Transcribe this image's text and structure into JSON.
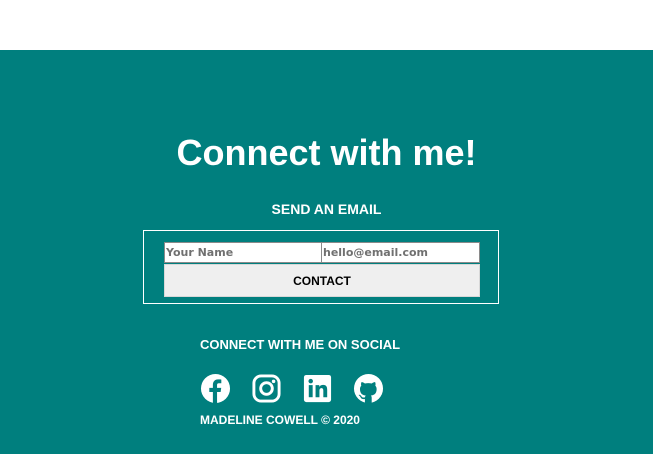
{
  "contact": {
    "heading": "Connect with me!",
    "subheading": "SEND AN EMAIL",
    "name_placeholder": "Your Name",
    "email_placeholder": "hello@email.com",
    "button_label": "CONTACT"
  },
  "social": {
    "heading": "CONNECT WITH ME ON SOCIAL",
    "icons": [
      "facebook-icon",
      "instagram-icon",
      "linkedin-icon",
      "github-icon"
    ]
  },
  "footer": {
    "copyright": "MADELINE COWELL © 2020"
  },
  "colors": {
    "background": "#007f7e",
    "text": "#ffffff",
    "button": "#efefef"
  }
}
